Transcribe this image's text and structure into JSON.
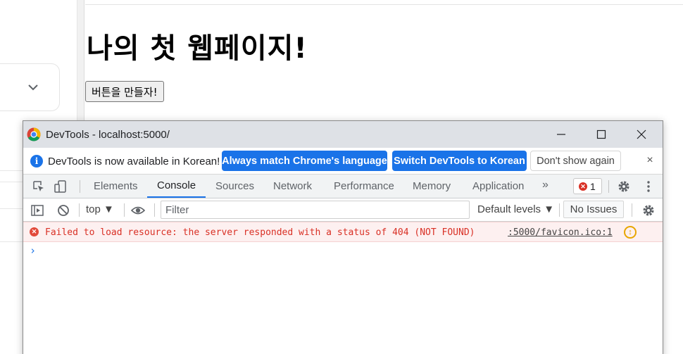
{
  "page": {
    "title": "나의 첫 웹페이지!",
    "button_label": "버튼을 만들자!"
  },
  "devtools": {
    "window_title": "DevTools - localhost:5000/",
    "infobar": {
      "message": "DevTools is now available in Korean!",
      "match_label": "Always match Chrome's language",
      "switch_label": "Switch DevTools to Korean",
      "dont_show_label": "Don't show again",
      "close_symbol": "×"
    },
    "tabs": [
      {
        "label": "Elements",
        "active": false
      },
      {
        "label": "Console",
        "active": true
      },
      {
        "label": "Sources",
        "active": false
      },
      {
        "label": "Network",
        "active": false
      },
      {
        "label": "Performance",
        "active": false
      },
      {
        "label": "Memory",
        "active": false
      },
      {
        "label": "Application",
        "active": false
      }
    ],
    "more_tabs_symbol": "»",
    "error_count": "1",
    "console_toolbar": {
      "context": "top ▼",
      "filter_placeholder": "Filter",
      "levels_label": "Default levels ▼",
      "issues_label": "No Issues"
    },
    "messages": [
      {
        "level": "error",
        "text": "Failed to load resource: the server responded with a status of 404 (NOT FOUND)",
        "source": ":5000/favicon.ico:1"
      }
    ],
    "prompt_symbol": "›"
  },
  "colors": {
    "accent": "#1a73e8",
    "error": "#d93025",
    "error_bg": "#fdf0f0",
    "titlebar_bg": "#dee1e6",
    "tabbar_bg": "#f1f3f4"
  },
  "icons": {
    "left_card": "chevron-down-icon",
    "titlebar": "chrome-logo-icon",
    "window_controls": [
      "minimize-icon",
      "maximize-icon",
      "close-icon"
    ],
    "infobar": "info-icon",
    "tabbar_tools": [
      "inspect-element-icon",
      "device-toolbar-icon"
    ],
    "tabbar_right": [
      "gear-icon",
      "kebab-menu-icon"
    ],
    "console_tools": [
      "sidebar-toggle-icon",
      "clear-console-icon",
      "eye-icon",
      "gear-icon"
    ],
    "message": [
      "error-icon",
      "warning-circle-icon"
    ]
  }
}
